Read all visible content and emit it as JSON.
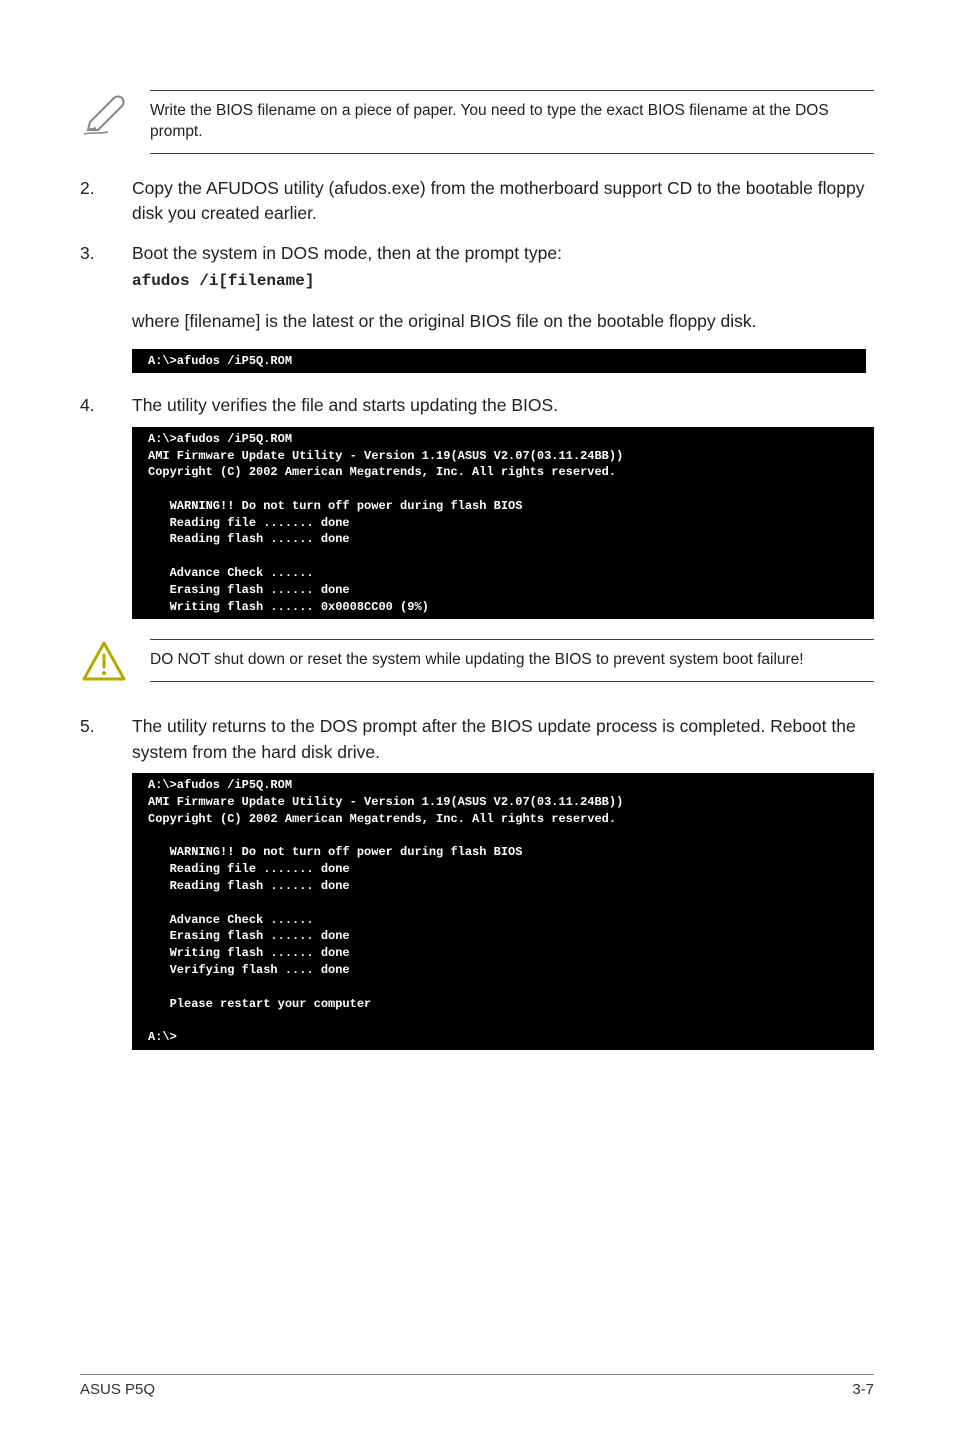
{
  "note1": "Write the BIOS filename on a piece of paper. You need to type the exact BIOS filename at the DOS prompt.",
  "steps": {
    "s2": {
      "num": "2.",
      "text": "Copy the AFUDOS utility (afudos.exe) from the motherboard support CD to the bootable floppy disk you created earlier."
    },
    "s3": {
      "num": "3.",
      "text": "Boot the system in DOS mode, then at the prompt type:"
    },
    "s4": {
      "num": "4.",
      "text": "The utility verifies the file and starts updating the BIOS."
    },
    "s5": {
      "num": "5.",
      "text": "The utility returns to the DOS prompt after the BIOS update process is completed. Reboot the system from the hard disk drive."
    }
  },
  "cmd": "afudos /i[filename]",
  "where_text": "where [filename] is the latest or the original BIOS file on the bootable floppy disk.",
  "term1": "A:\\>afudos /iP5Q.ROM",
  "term2": "A:\\>afudos /iP5Q.ROM\nAMI Firmware Update Utility - Version 1.19(ASUS V2.07(03.11.24BB))\nCopyright (C) 2002 American Megatrends, Inc. All rights reserved.\n\n   WARNING!! Do not turn off power during flash BIOS\n   Reading file ....... done\n   Reading flash ...... done\n\n   Advance Check ......\n   Erasing flash ...... done\n   Writing flash ...... 0x0008CC00 (9%)\n",
  "warning": "DO NOT shut down or reset the system while updating the BIOS to prevent system boot failure!",
  "term3": "A:\\>afudos /iP5Q.ROM\nAMI Firmware Update Utility - Version 1.19(ASUS V2.07(03.11.24BB))\nCopyright (C) 2002 American Megatrends, Inc. All rights reserved.\n\n   WARNING!! Do not turn off power during flash BIOS\n   Reading file ....... done\n   Reading flash ...... done\n\n   Advance Check ......\n   Erasing flash ...... done\n   Writing flash ...... done\n   Verifying flash .... done\n\n   Please restart your computer\n\nA:\\>",
  "footer": {
    "left": "ASUS P5Q",
    "right": "3-7"
  }
}
